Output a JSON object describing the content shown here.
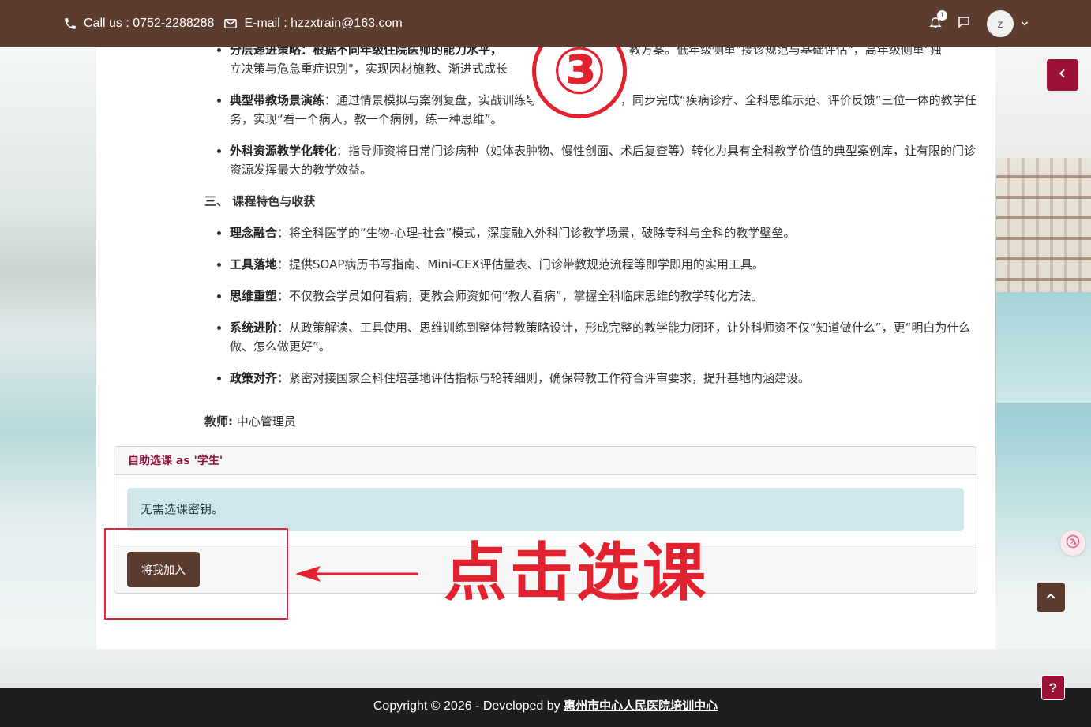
{
  "header": {
    "phone": "Call us : 0752-2288288",
    "email": "E-mail : hzzxtrain@163.com",
    "notification_count": "1",
    "avatar_initial": "z"
  },
  "content": {
    "partial_line_1": "分层递进策略：根据不同年级住院医师的能力水平，",
    "partial_line_1_right": "教方案。低年级侧重\"接诊规范与基础评估\"，高年级侧重\"独",
    "partial_line_2": "立决策与危急重症识别\"，实现因材施教、渐进式成长",
    "bullets_top": [
      {
        "bold": "典型带教场景演练",
        "text": "：通过情景模拟与案例复盘，实战训练导师在门诊场景中，同步完成“疾病诊疗、全科思维示范、评价反馈”三位一体的教学任务，实现“看一个病人，教一个病例，练一种思维”。"
      },
      {
        "bold": "外科资源教学化转化",
        "text": "：指导师资将日常门诊病种（如体表肿物、慢性创面、术后复查等）转化为具有全科教学价值的典型案例库，让有限的门诊资源发挥最大的教学效益。"
      }
    ],
    "section_title": "三、 课程特色与收获",
    "bullets_bottom": [
      {
        "bold": "理念融合",
        "text": "：将全科医学的“生物-心理-社会”模式，深度融入外科门诊教学场景，破除专科与全科的教学壁垒。"
      },
      {
        "bold": "工具落地",
        "text": "：提供SOAP病历书写指南、Mini-CEX评估量表、门诊带教规范流程等即学即用的实用工具。"
      },
      {
        "bold": "思维重塑",
        "text": "：不仅教会学员如何看病，更教会师资如何“教人看病”，掌握全科临床思维的教学转化方法。"
      },
      {
        "bold": "系统进阶",
        "text": "：从政策解读、工具使用、思维训练到整体带教策略设计，形成完整的教学能力闭环，让外科师资不仅“知道做什么”，更“明白为什么做、怎么做更好”。"
      },
      {
        "bold": "政策对齐",
        "text": "：紧密对接国家全科住培基地评估指标与轮转细则，确保带教工作符合评审要求，提升基地内涵建设。"
      }
    ],
    "teacher_label": "教师:",
    "teacher_name": "中心管理员"
  },
  "enrol": {
    "title": "自助选课 as '学生'",
    "notice": "无需选课密钥。",
    "button_label": "将我加入"
  },
  "annotation": {
    "step_number": "③",
    "callout": "点击选课"
  },
  "footer": {
    "text": "Copyright © 2026 - Developed by ",
    "link": "惠州市中心人民医院培训中心"
  },
  "help_label": "?",
  "colors": {
    "brand_brown": "#5c3c2e",
    "accent_crimson": "#9c1136",
    "annotation_red": "#e3222f",
    "alert_bg": "#cfe6ea"
  }
}
